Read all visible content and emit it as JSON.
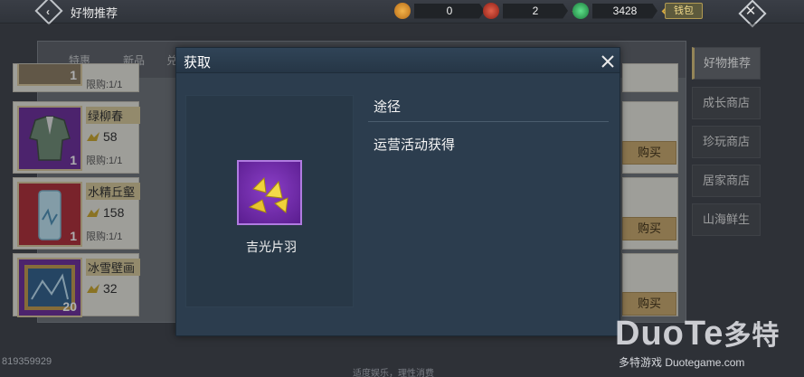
{
  "topbar": {
    "title": "好物推荐",
    "currencies": [
      {
        "value": "0",
        "icon": "bell-coin-icon",
        "color": "#d08a2a"
      },
      {
        "value": "2",
        "icon": "red-token-icon",
        "color": "#c33a2a"
      },
      {
        "value": "3428",
        "icon": "green-jade-icon",
        "color": "#2fae57"
      }
    ],
    "wallet_label": "钱包"
  },
  "shop": {
    "tabs": [
      "特惠",
      "新品",
      "兑"
    ],
    "items": [
      {
        "name": "绿柳春",
        "price": "58",
        "limit": "限购:1/1",
        "qty": "1",
        "thumb_color": "#6a2a9a"
      },
      {
        "name": "水精丘壑",
        "price": "158",
        "limit": "限购:1/1",
        "qty": "1",
        "thumb_color": "#b02a35"
      },
      {
        "name": "冰雪壁画",
        "price": "32",
        "limit": "",
        "qty": "20",
        "thumb_color": "#6a2a9a"
      }
    ],
    "partial_limit": "限购:1/1",
    "partial_qty": "1",
    "buy_label": "购买"
  },
  "side_nav": {
    "items": [
      "好物推荐",
      "成长商店",
      "珍玩商店",
      "居家商店",
      "山海鲜生"
    ],
    "active_index": 0
  },
  "modal": {
    "title": "获取",
    "close_icon": "close-icon",
    "item_name": "吉光片羽",
    "source_header": "途径",
    "source_text": "运营活动获得",
    "icon_color": "#7a34b8"
  },
  "footer": {
    "code": "819359929",
    "note": "适度娱乐，理性消费"
  },
  "watermark": {
    "logo": "DuoTe",
    "logo_cn": "多特",
    "sub": "多特游戏 Duotegame.com"
  }
}
